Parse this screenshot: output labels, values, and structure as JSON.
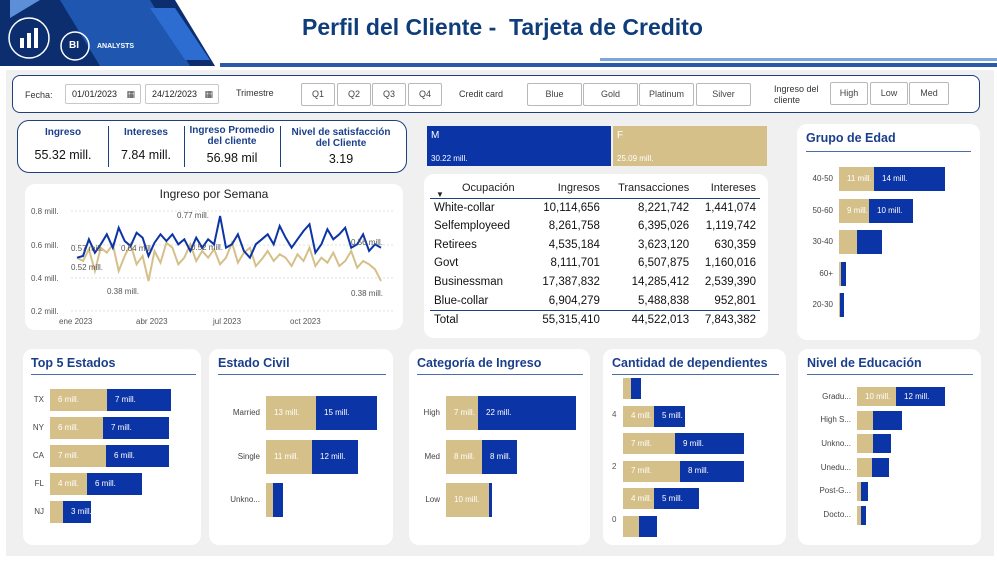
{
  "header": {
    "title": "Perfil del Cliente -  Tarjeta de Credito",
    "logo_text": "BI",
    "logo_subtext": "ANALYSTS"
  },
  "colors": {
    "gold": "#d6c089",
    "blue": "#0b34a6",
    "title": "#0f3d7a",
    "border": "#1f3f7f"
  },
  "filters": {
    "fecha_label": "Fecha:",
    "date_from": "01/01/2023",
    "date_to": "24/12/2023",
    "trimestre_label": "Trimestre",
    "trimestre_options": [
      "Q1",
      "Q2",
      "Q3",
      "Q4"
    ],
    "credit_card_label": "Credit card",
    "credit_card_options": [
      "Blue",
      "Gold",
      "Platinum",
      "Silver"
    ],
    "ingreso_label_line1": "Ingreso del",
    "ingreso_label_line2": "cliente",
    "ingreso_options": [
      "High",
      "Low",
      "Med"
    ]
  },
  "kpis": [
    {
      "label": "Ingreso",
      "value": "55.32 mill."
    },
    {
      "label": "Intereses",
      "value": "7.84 mill."
    },
    {
      "label_line1": "Ingreso Promedio",
      "label_line2": "del cliente",
      "value": "56.98 mil"
    },
    {
      "label_line1": "Nivel de satisfacción",
      "label_line2": "del Cliente",
      "value": "3.19"
    }
  ],
  "gender": [
    {
      "label": "M",
      "value": "30.22 mill."
    },
    {
      "label": "F",
      "value": "25.09 mill."
    }
  ],
  "weekly": {
    "title": "Ingreso por Semana",
    "y_ticks": [
      "0.8 mill.",
      "0.6 mill.",
      "0.4 mill.",
      "0.2 mill."
    ],
    "x_ticks": [
      "ene 2023",
      "abr 2023",
      "jul 2023",
      "oct 2023"
    ],
    "annotations": [
      "0.77 mill.",
      "0.57 mill.",
      "0.64 mill.",
      "0.52 mill.",
      "0.38 mill.",
      "0.52 mill.",
      "0.56 mill.",
      "0.38 mill."
    ]
  },
  "occupation_table": {
    "columns": [
      "Ocupación",
      "Ingresos",
      "Transacciones",
      "Intereses"
    ],
    "rows": [
      [
        "White-collar",
        "10,114,656",
        "8,221,742",
        "1,441,074"
      ],
      [
        "Selfemployeed",
        "8,261,758",
        "6,395,026",
        "1,119,742"
      ],
      [
        "Retirees",
        "4,535,184",
        "3,623,120",
        "630,359"
      ],
      [
        "Govt",
        "8,111,701",
        "6,507,875",
        "1,160,016"
      ],
      [
        "Businessman",
        "17,387,832",
        "14,285,412",
        "2,539,390"
      ],
      [
        "Blue-collar",
        "6,904,279",
        "5,488,838",
        "952,801"
      ]
    ],
    "total": [
      "Total",
      "55,315,410",
      "44,522,013",
      "7,843,382"
    ]
  },
  "age_group": {
    "title": "Grupo de Edad",
    "rows": [
      {
        "label": "40-50",
        "gold_label": "11 mill.",
        "blue_label": "14 mill."
      },
      {
        "label": "50-60",
        "gold_label": "9 mill.",
        "blue_label": "10 mill."
      },
      {
        "label": "30-40",
        "gold_label": "",
        "blue_label": ""
      },
      {
        "label": "60+",
        "gold_label": "",
        "blue_label": ""
      },
      {
        "label": "20-30",
        "gold_label": "",
        "blue_label": ""
      }
    ]
  },
  "top_states": {
    "title": "Top 5 Estados",
    "rows": [
      {
        "label": "TX",
        "gold_label": "6 mill.",
        "blue_label": "7 mill."
      },
      {
        "label": "NY",
        "gold_label": "6 mill.",
        "blue_label": "7 mill."
      },
      {
        "label": "CA",
        "gold_label": "7 mill.",
        "blue_label": "6 mill."
      },
      {
        "label": "FL",
        "gold_label": "4 mill.",
        "blue_label": "6 mill."
      },
      {
        "label": "NJ",
        "gold_label": "",
        "blue_label": "3 mill."
      }
    ]
  },
  "marital": {
    "title": "Estado Civil",
    "rows": [
      {
        "label": "Married",
        "gold_label": "13 mill.",
        "blue_label": "15 mill."
      },
      {
        "label": "Single",
        "gold_label": "11 mill.",
        "blue_label": "12 mill."
      },
      {
        "label": "Unkno...",
        "gold_label": "",
        "blue_label": ""
      }
    ]
  },
  "income_cat": {
    "title": "Categoría de Ingreso",
    "rows": [
      {
        "label": "High",
        "gold_label": "7 mill.",
        "blue_label": "22 mill."
      },
      {
        "label": "Med",
        "gold_label": "8 mill.",
        "blue_label": "8 mill."
      },
      {
        "label": "Low",
        "gold_label": "10 mill.",
        "blue_label": ""
      }
    ]
  },
  "dependents": {
    "title": "Cantidad de dependientes",
    "axis": [
      "4",
      "2",
      "0"
    ],
    "rows": [
      {
        "gold_label": "",
        "blue_label": ""
      },
      {
        "gold_label": "4 mill.",
        "blue_label": "5 mill."
      },
      {
        "gold_label": "7 mill.",
        "blue_label": "9 mill."
      },
      {
        "gold_label": "7 mill.",
        "blue_label": "8 mill."
      },
      {
        "gold_label": "4 mill.",
        "blue_label": "5 mill."
      },
      {
        "gold_label": "",
        "blue_label": ""
      }
    ]
  },
  "education": {
    "title": "Nivel de Educación",
    "rows": [
      {
        "label": "Gradu...",
        "gold_label": "10 mill.",
        "blue_label": "12 mill."
      },
      {
        "label": "High S...",
        "gold_label": "",
        "blue_label": ""
      },
      {
        "label": "Unkno...",
        "gold_label": "",
        "blue_label": ""
      },
      {
        "label": "Unedu...",
        "gold_label": "",
        "blue_label": ""
      },
      {
        "label": "Post-G...",
        "gold_label": "",
        "blue_label": ""
      },
      {
        "label": "Docto...",
        "gold_label": "",
        "blue_label": ""
      }
    ]
  }
}
